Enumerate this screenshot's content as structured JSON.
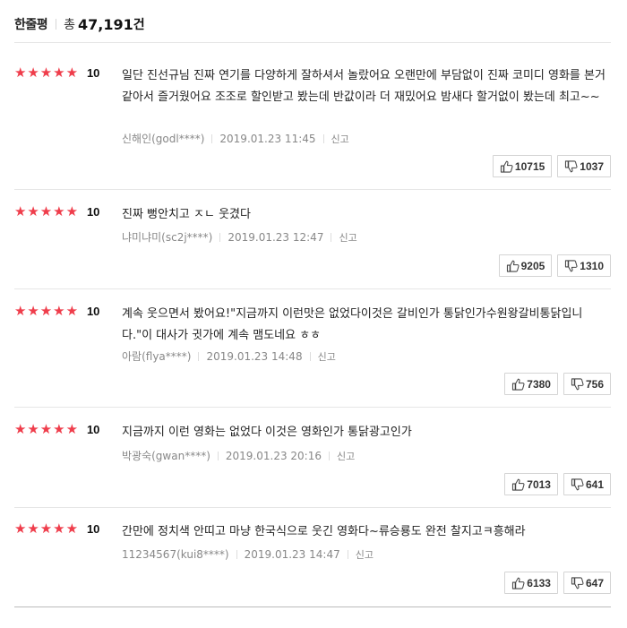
{
  "header": {
    "title": "한줄평",
    "count_prefix": "총",
    "count_number": "47,191",
    "count_unit": "건"
  },
  "star_glyph": "★",
  "star_color": "#ef3d4b",
  "reviews": [
    {
      "score": "10",
      "stars": 5,
      "text": "일단 진선규님 진짜 연기를 다양하게 잘하셔서 놀랐어요 오랜만에 부담없이 진짜 코미디 영화를 본거 같아서 즐거웠어요 조조로 할인받고 봤는데 반값이라 더 재밌어요 밤새다 할거없이 봤는데 최고~~",
      "author": "신해인(godl****)",
      "date": "2019.01.23 11:45",
      "report": "신고",
      "likes": "10715",
      "dislikes": "1037"
    },
    {
      "score": "10",
      "stars": 5,
      "text": "진짜 뻥안치고 ㅈㄴ 웃겼다",
      "author": "냐미냐미(sc2j****)",
      "date": "2019.01.23 12:47",
      "report": "신고",
      "likes": "9205",
      "dislikes": "1310"
    },
    {
      "score": "10",
      "stars": 5,
      "text": "계속 웃으면서 봤어요!\"지금까지 이런맛은 없었다이것은 갈비인가 통닭인가수원왕갈비통닭입니다.\"이 대사가 귓가에 계속 맴도네요 ㅎㅎ",
      "author": "아람(flya****)",
      "date": "2019.01.23 14:48",
      "report": "신고",
      "likes": "7380",
      "dislikes": "756"
    },
    {
      "score": "10",
      "stars": 5,
      "text": "지금까지 이런 영화는 없었다 이것은 영화인가 통닭광고인가",
      "author": "박광숙(gwan****)",
      "date": "2019.01.23 20:16",
      "report": "신고",
      "likes": "7013",
      "dislikes": "641"
    },
    {
      "score": "10",
      "stars": 5,
      "text": "간만에 정치색 안띠고 마냥 한국식으로 웃긴 영화다~류승룡도 완전 찰지고ㅋ흥해라",
      "author": "11234567(kui8****)",
      "date": "2019.01.23 14:47",
      "report": "신고",
      "likes": "6133",
      "dislikes": "647"
    }
  ]
}
